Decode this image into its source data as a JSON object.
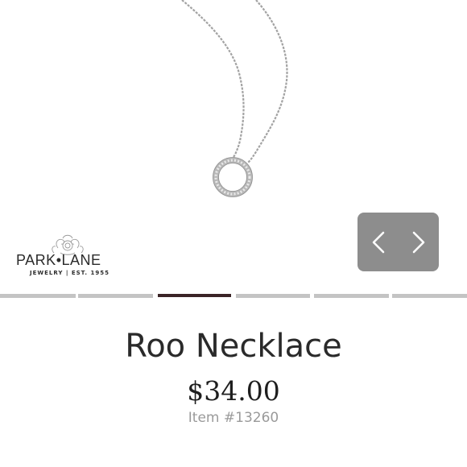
{
  "brand": {
    "name_left": "PARK",
    "name_sep": "•",
    "name_right": "LANE",
    "tagline": "JEWELRY | EST. 1955"
  },
  "product": {
    "title": "Roo Necklace",
    "price": "$34.00",
    "item_number": "Item #13260",
    "image_icon": "circle-pendant-necklace"
  },
  "navigation": {
    "prev_icon": "chevron-left-icon",
    "next_icon": "chevron-right-icon"
  },
  "carousel": {
    "slide_count": 6,
    "active_index": 2
  },
  "colors": {
    "nav_bg": "#8d8d8d",
    "dot_inactive": "#c4c4c4",
    "dot_active": "#3a2426",
    "title": "#2a2a2a",
    "item_no": "#9a9a9a"
  }
}
